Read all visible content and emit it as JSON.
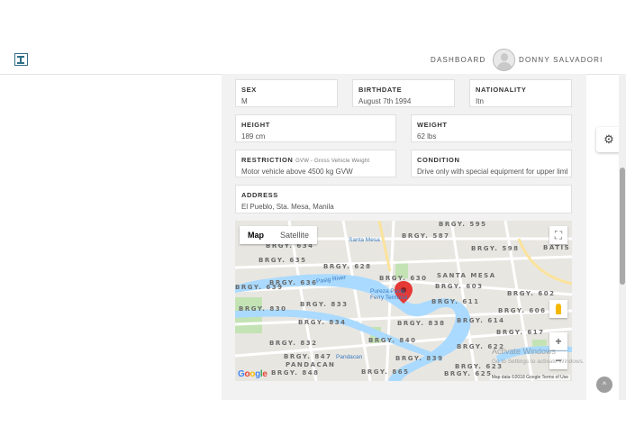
{
  "header": {
    "dashboard_label": "DASHBOARD",
    "user_name": "DONNY SALVADORI"
  },
  "profile": {
    "sex": {
      "label": "SEX",
      "value": "M"
    },
    "birthdate": {
      "label": "BIRTHDATE",
      "value": "August 7th 1994"
    },
    "nationality": {
      "label": "NATIONALITY",
      "value": "Itn"
    },
    "height": {
      "label": "HEIGHT",
      "value": "189 cm"
    },
    "weight": {
      "label": "WEIGHT",
      "value": "62 lbs"
    },
    "restriction": {
      "label": "RESTRICTION",
      "sublabel": "GVW - Gross Vehicle Weight",
      "value": "Motor vehicle above 4500 kg GVW"
    },
    "condition": {
      "label": "CONDITION",
      "value": "Drive only with special equipment for upper limbs"
    },
    "address": {
      "label": "ADDRESS",
      "value": "El Pueblo, Sta. Mesa, Manila"
    }
  },
  "map": {
    "tab_map": "Map",
    "tab_satellite": "Satellite",
    "labels": [
      "BRGY. 595",
      "BRGY. 587",
      "BRGY. 598",
      "BATIS",
      "BRGY. 634",
      "BRGY. 635",
      "BRGY. 628",
      "SANTA MESA",
      "BRGY. 603",
      "BRGY. 636",
      "BRGY. 630",
      "BRGY. 611",
      "BRGY. 602",
      "BRGY. 639",
      "BRGY. 833",
      "BRGY. 830",
      "BRGY. 606",
      "BRGY. 834",
      "BRGY. 838",
      "BRGY. 614",
      "BRGY. 617",
      "BRGY. 832",
      "BRGY. 840",
      "BRGY. 847",
      "BRGY. 622",
      "PANDACAN",
      "BRGY. 839",
      "BRGY. 623",
      "BRGY. 848",
      "BRGY. 865",
      "BRGY. 625"
    ],
    "places": {
      "santa_mesa_market": "Santa Mesa",
      "pasig_river": "Pasig River",
      "pureza_terminal": "Pureza Pasig\nFerry Terminal",
      "pandacan": "Pandacan"
    },
    "google_letters": [
      "G",
      "o",
      "o",
      "g",
      "l",
      "e"
    ],
    "attribution": "Map data ©2018 Google   Terms of Use",
    "watermark_title": "Activate Windows",
    "watermark_sub": "Go to Settings to activate Windows.",
    "colors": {
      "water": "#aadaff",
      "land": "#e8e6e1",
      "road": "#ffffff",
      "park": "#c4e3b5",
      "pin": "#e53935"
    }
  },
  "ui": {
    "gear_icon": "⚙",
    "scroll_up_icon": "^"
  }
}
